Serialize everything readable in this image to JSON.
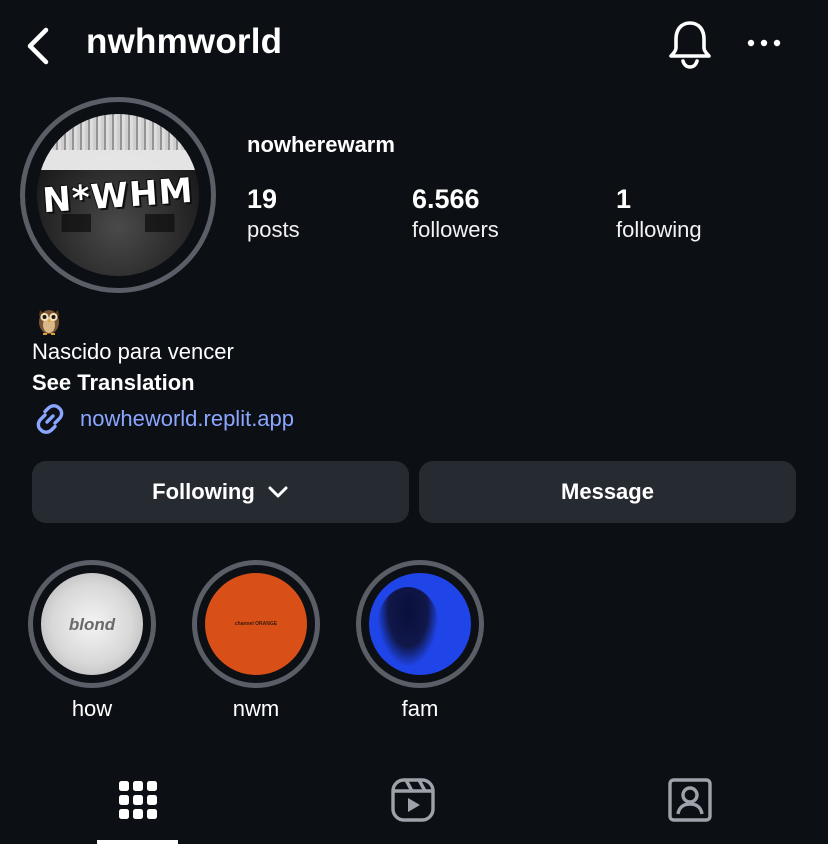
{
  "header": {
    "title": "nwhmworld",
    "icons": {
      "back": "chevron-left-icon",
      "notifications": "bell-icon",
      "more": "more-horizontal-icon"
    }
  },
  "profile": {
    "display_name": "nowherewarm",
    "avatar_logo_text": "N*WHM",
    "stats": [
      {
        "value": "19",
        "label": "posts"
      },
      {
        "value": "6.566",
        "label": "followers"
      },
      {
        "value": "1",
        "label": "following"
      }
    ],
    "bio": {
      "emoji": "owl-emoji",
      "text": "Nascido para vencer",
      "translate_label": "See Translation",
      "link": "nowheworld.replit.app"
    }
  },
  "actions": {
    "following_label": "Following",
    "message_label": "Message"
  },
  "highlights": [
    {
      "label": "how",
      "cover_text": "blond"
    },
    {
      "label": "nwm",
      "cover_text": "channel ORANGE"
    },
    {
      "label": "fam"
    }
  ],
  "tabs": [
    {
      "name": "grid",
      "icon": "grid-icon",
      "active": true
    },
    {
      "name": "reels",
      "icon": "reels-icon",
      "active": false
    },
    {
      "name": "tagged",
      "icon": "tagged-person-icon",
      "active": false
    }
  ],
  "colors": {
    "background": "#0c0f14",
    "button": "#262a31",
    "ring": "#5b5e66",
    "link": "#8aa6ff",
    "text": "#ffffff"
  }
}
